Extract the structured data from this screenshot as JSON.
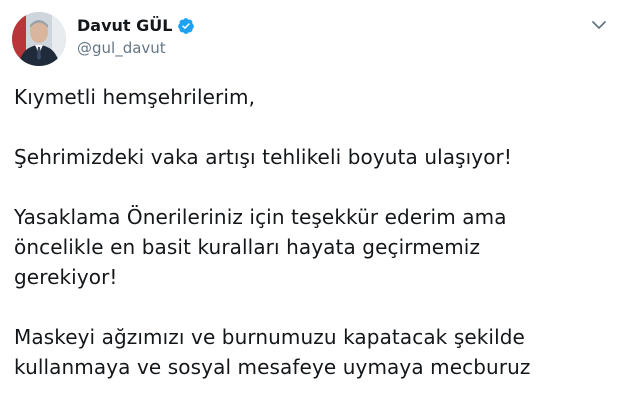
{
  "author": {
    "display_name": "Davut GÜL",
    "handle": "@gul_davut",
    "verified": true,
    "avatar_icon": "profile-photo",
    "verified_icon": "verified-badge-icon",
    "menu_icon": "chevron-down-icon"
  },
  "tweet": {
    "paragraphs": [
      {
        "lines": [
          "Kıymetli hemşehrilerim,"
        ]
      },
      {
        "lines": [
          "Şehrimizdeki vaka artışı tehlikeli boyuta ulaşıyor!"
        ]
      },
      {
        "lines": [
          "Yasaklama Önerileriniz için teşekkür ederim ama",
          "öncelikle en basit kuralları hayata geçirmemiz",
          "gerekiyor!"
        ]
      },
      {
        "lines": [
          "Maskeyi ağzımızı ve burnumuzu kapatacak şekilde",
          "kullanmaya ve sosyal mesafeye uymaya mecburuz"
        ]
      }
    ]
  },
  "colors": {
    "text": "#14171a",
    "secondary": "#657786",
    "verified": "#1da1f2"
  }
}
